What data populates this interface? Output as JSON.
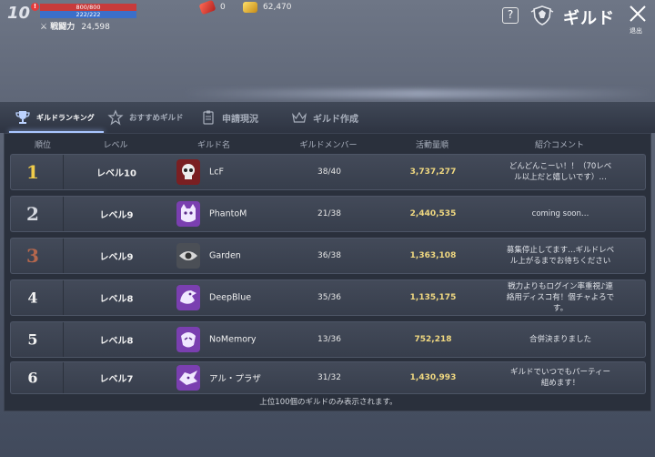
{
  "status": {
    "level": "10",
    "alert": "!",
    "hp": "800/800",
    "mp": "222/222",
    "power_label": "戦闘力",
    "power_value": "24,598",
    "currency1": "0",
    "currency2": "62,470"
  },
  "header": {
    "help": "?",
    "title": "ギルド",
    "exit_label": "退出"
  },
  "tabs": [
    {
      "label": "ギルドランキング",
      "icon": "trophy-icon"
    },
    {
      "label": "おすすめギルド",
      "icon": "star-icon"
    },
    {
      "label": "申請現況",
      "icon": "clipboard-icon"
    },
    {
      "label": "ギルド作成",
      "icon": "crown-icon"
    }
  ],
  "table": {
    "headers": {
      "rank": "順位",
      "level": "レベル",
      "name": "ギルド名",
      "members": "ギルドメンバー",
      "activity": "活動量順",
      "comment": "紹介コメント"
    },
    "rows": [
      {
        "rank": "1",
        "level": "レベル10",
        "name": "LcF",
        "members": "38/40",
        "activity": "3,737,277",
        "comment": "どんどんこーい！！（70レベ\nル以上だと嬉しいです）…"
      },
      {
        "rank": "2",
        "level": "レベル9",
        "name": "PhantoM",
        "members": "21/38",
        "activity": "2,440,535",
        "comment": "coming soon…"
      },
      {
        "rank": "3",
        "level": "レベル9",
        "name": "Garden",
        "members": "36/38",
        "activity": "1,363,108",
        "comment": "募集停止してます…ギルドレベ\nル上がるまでお待ちください"
      },
      {
        "rank": "4",
        "level": "レベル8",
        "name": "DeepBlue",
        "members": "35/36",
        "activity": "1,135,175",
        "comment": "戦力よりもログイン率重視♪連\n絡用ディスコ有！個チャよろで\nす。"
      },
      {
        "rank": "5",
        "level": "レベル8",
        "name": "NoMemory",
        "members": "13/36",
        "activity": "752,218",
        "comment": "合併決まりました"
      },
      {
        "rank": "6",
        "level": "レベル7",
        "name": "アル・プラザ",
        "members": "31/32",
        "activity": "1,430,993",
        "comment": "ギルドでいつでもパーティー\n組めます！"
      }
    ],
    "footer": "上位100個のギルドのみ表示されます。"
  },
  "colors": {
    "accent": "#a9c6ff",
    "activity": "#f0d880",
    "gold": "#f0cc4a",
    "bronze": "#b5674d"
  }
}
